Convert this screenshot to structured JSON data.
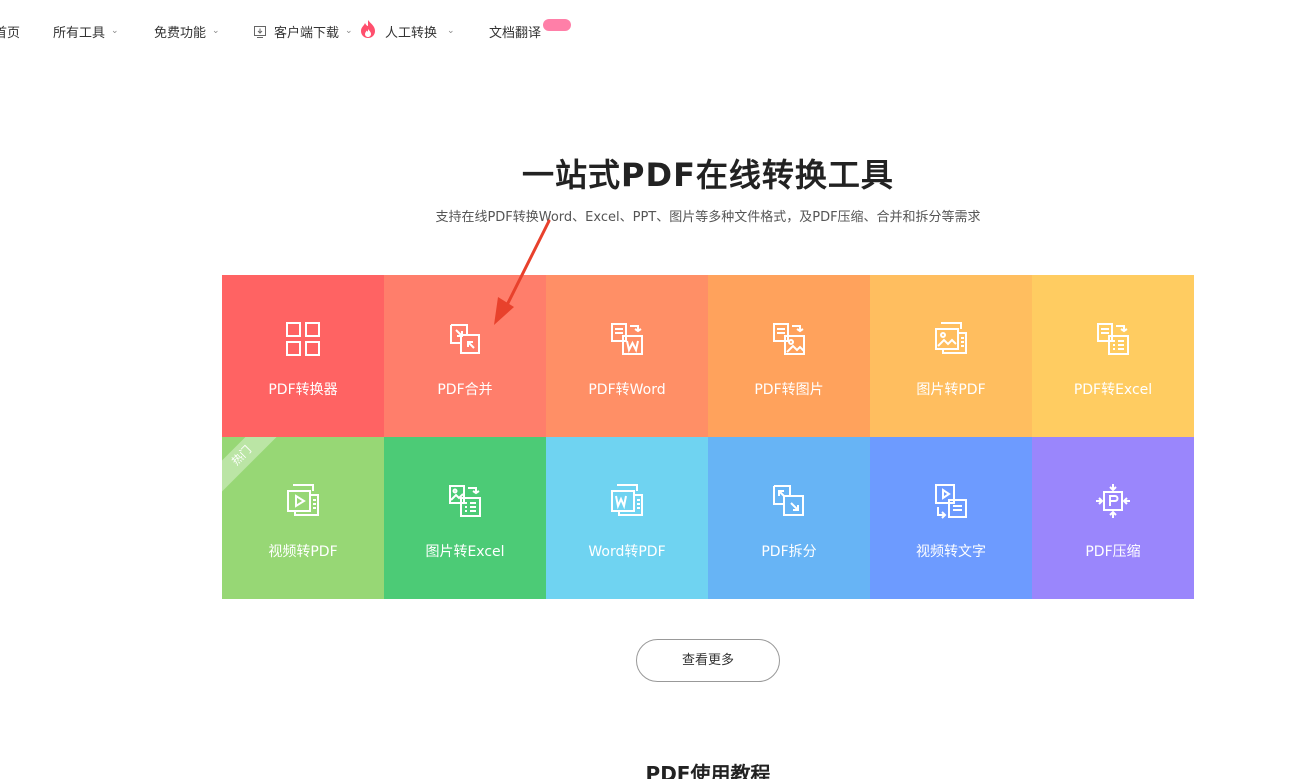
{
  "nav": {
    "home": "首页",
    "all_tools": "所有工具",
    "free_features": "免费功能",
    "client_download": "客户端下载",
    "human_convert": "人工转换",
    "doc_translate": "文档翻译",
    "chevron_icon": "chevron-down-icon",
    "download_icon": "download-icon",
    "flame_icon": "flame-icon",
    "badge_color": "#ff7fa8"
  },
  "hero": {
    "title": "一站式PDF在线转换工具",
    "subtitle": "支持在线PDF转换Word、Excel、PPT、图片等多种文件格式，及PDF压缩、合并和拆分等需求"
  },
  "tools": [
    {
      "label": "PDF转换器",
      "icon": "grid-icon",
      "color": "#ff6363"
    },
    {
      "label": "PDF合并",
      "icon": "merge-icon",
      "color": "#ff7e6b"
    },
    {
      "label": "PDF转Word",
      "icon": "pdf-to-word-icon",
      "color": "#ff8f66"
    },
    {
      "label": "PDF转图片",
      "icon": "pdf-to-image-icon",
      "color": "#ffa25c"
    },
    {
      "label": "图片转PDF",
      "icon": "image-to-pdf-icon",
      "color": "#ffbe5f"
    },
    {
      "label": "PDF转Excel",
      "icon": "pdf-to-excel-icon",
      "color": "#ffcc61"
    },
    {
      "label": "视频转PDF",
      "icon": "video-to-pdf-icon",
      "color": "#97d775",
      "badge": "热门"
    },
    {
      "label": "图片转Excel",
      "icon": "image-to-excel-icon",
      "color": "#4ccb76"
    },
    {
      "label": "Word转PDF",
      "icon": "word-to-pdf-icon",
      "color": "#6fd3f1"
    },
    {
      "label": "PDF拆分",
      "icon": "split-icon",
      "color": "#67b4f5"
    },
    {
      "label": "视频转文字",
      "icon": "video-to-text-icon",
      "color": "#6d9bff"
    },
    {
      "label": "PDF压缩",
      "icon": "compress-icon",
      "color": "#9a86fc"
    }
  ],
  "more_button": "查看更多",
  "tutorial_title": "PDF使用教程",
  "annotation": {
    "icon": "red-arrow-icon",
    "color": "#e8412c"
  }
}
